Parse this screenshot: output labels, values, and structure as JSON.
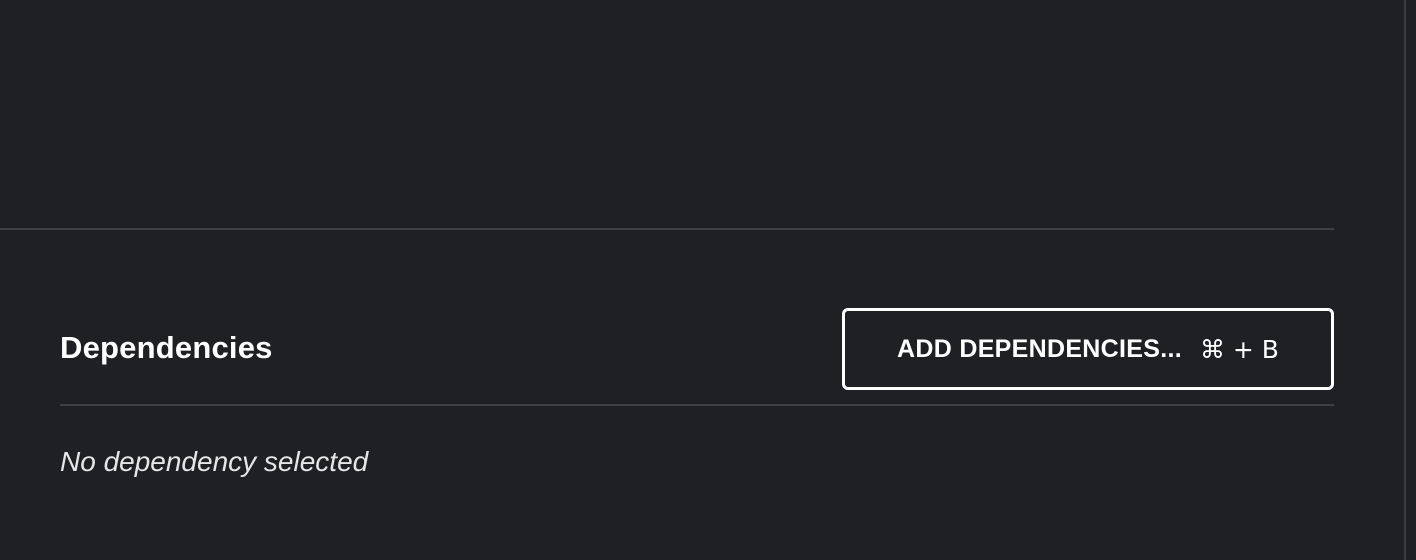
{
  "dependencies": {
    "title": "Dependencies",
    "add_button_label": "ADD DEPENDENCIES...",
    "add_button_shortcut": "⌘ + B",
    "empty_message": "No dependency selected"
  }
}
